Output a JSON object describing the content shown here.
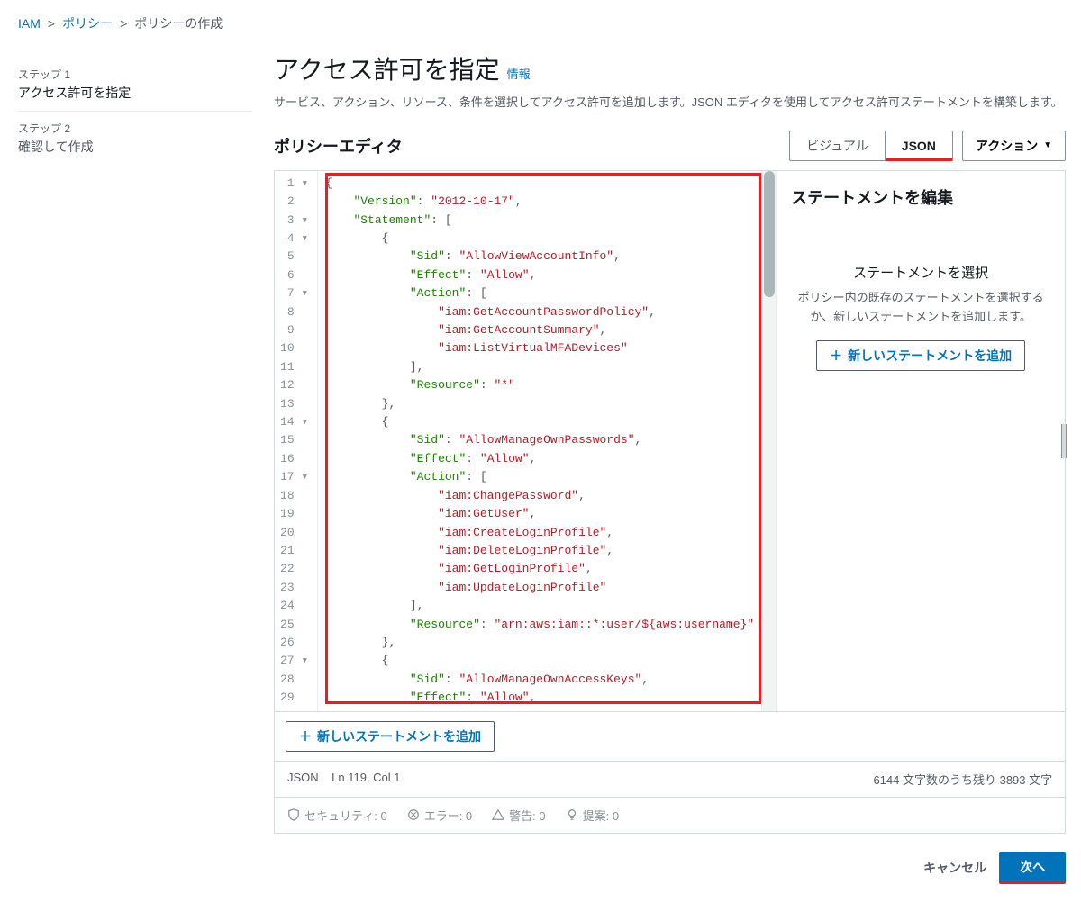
{
  "breadcrumb": {
    "iam": "IAM",
    "policy": "ポリシー",
    "create": "ポリシーの作成"
  },
  "steps": {
    "s1_label": "ステップ 1",
    "s1_title": "アクセス許可を指定",
    "s2_label": "ステップ 2",
    "s2_title": "確認して作成"
  },
  "page": {
    "title": "アクセス許可を指定",
    "info": "情報",
    "desc": "サービス、アクション、リソース、条件を選択してアクセス許可を追加します。JSON エディタを使用してアクセス許可ステートメントを構築します。"
  },
  "editor": {
    "title": "ポリシーエディタ",
    "visual": "ビジュアル",
    "json": "JSON",
    "actions": "アクション"
  },
  "statement_panel": {
    "title": "ステートメントを編集",
    "sel_title": "ステートメントを選択",
    "sel_desc": "ポリシー内の既存のステートメントを選択するか、新しいステートメントを追加します。",
    "add_btn": "新しいステートメントを追加"
  },
  "add_statement_btn2": "新しいステートメントを追加",
  "status": {
    "mode": "JSON",
    "cursor": "Ln 119, Col 1",
    "chars": "6144 文字数のうち残り 3893 文字"
  },
  "diagnostics": {
    "security": "セキュリティ: 0",
    "errors": "エラー: 0",
    "warnings": "警告: 0",
    "suggestions": "提案: 0"
  },
  "footer": {
    "cancel": "キャンセル",
    "next": "次へ"
  },
  "policy_json": {
    "Version": "2012-10-17",
    "Statement": [
      {
        "Sid": "AllowViewAccountInfo",
        "Effect": "Allow",
        "Action": [
          "iam:GetAccountPasswordPolicy",
          "iam:GetAccountSummary",
          "iam:ListVirtualMFADevices"
        ],
        "Resource": "*"
      },
      {
        "Sid": "AllowManageOwnPasswords",
        "Effect": "Allow",
        "Action": [
          "iam:ChangePassword",
          "iam:GetUser",
          "iam:CreateLoginProfile",
          "iam:DeleteLoginProfile",
          "iam:GetLoginProfile",
          "iam:UpdateLoginProfile"
        ],
        "Resource": "arn:aws:iam::*:user/${aws:username}"
      },
      {
        "Sid": "AllowManageOwnAccessKeys",
        "Effect": "Allow"
      }
    ]
  },
  "code_lines": [
    [
      [
        "p",
        "{"
      ]
    ],
    [
      [
        "p",
        "    "
      ],
      [
        "k",
        "\"Version\""
      ],
      [
        "p",
        ": "
      ],
      [
        "s",
        "\"2012-10-17\""
      ],
      [
        "p",
        ","
      ]
    ],
    [
      [
        "p",
        "    "
      ],
      [
        "k",
        "\"Statement\""
      ],
      [
        "p",
        ": ["
      ]
    ],
    [
      [
        "p",
        "        {"
      ]
    ],
    [
      [
        "p",
        "            "
      ],
      [
        "k",
        "\"Sid\""
      ],
      [
        "p",
        ": "
      ],
      [
        "s",
        "\"AllowViewAccountInfo\""
      ],
      [
        "p",
        ","
      ]
    ],
    [
      [
        "p",
        "            "
      ],
      [
        "k",
        "\"Effect\""
      ],
      [
        "p",
        ": "
      ],
      [
        "s",
        "\"Allow\""
      ],
      [
        "p",
        ","
      ]
    ],
    [
      [
        "p",
        "            "
      ],
      [
        "k",
        "\"Action\""
      ],
      [
        "p",
        ": ["
      ]
    ],
    [
      [
        "p",
        "                "
      ],
      [
        "s",
        "\"iam:GetAccountPasswordPolicy\""
      ],
      [
        "p",
        ","
      ]
    ],
    [
      [
        "p",
        "                "
      ],
      [
        "s",
        "\"iam:GetAccountSummary\""
      ],
      [
        "p",
        ","
      ]
    ],
    [
      [
        "p",
        "                "
      ],
      [
        "s",
        "\"iam:ListVirtualMFADevices\""
      ]
    ],
    [
      [
        "p",
        "            ],"
      ]
    ],
    [
      [
        "p",
        "            "
      ],
      [
        "k",
        "\"Resource\""
      ],
      [
        "p",
        ": "
      ],
      [
        "s",
        "\"*\""
      ]
    ],
    [
      [
        "p",
        "        },"
      ]
    ],
    [
      [
        "p",
        "        {"
      ]
    ],
    [
      [
        "p",
        "            "
      ],
      [
        "k",
        "\"Sid\""
      ],
      [
        "p",
        ": "
      ],
      [
        "s",
        "\"AllowManageOwnPasswords\""
      ],
      [
        "p",
        ","
      ]
    ],
    [
      [
        "p",
        "            "
      ],
      [
        "k",
        "\"Effect\""
      ],
      [
        "p",
        ": "
      ],
      [
        "s",
        "\"Allow\""
      ],
      [
        "p",
        ","
      ]
    ],
    [
      [
        "p",
        "            "
      ],
      [
        "k",
        "\"Action\""
      ],
      [
        "p",
        ": ["
      ]
    ],
    [
      [
        "p",
        "                "
      ],
      [
        "s",
        "\"iam:ChangePassword\""
      ],
      [
        "p",
        ","
      ]
    ],
    [
      [
        "p",
        "                "
      ],
      [
        "s",
        "\"iam:GetUser\""
      ],
      [
        "p",
        ","
      ]
    ],
    [
      [
        "p",
        "                "
      ],
      [
        "s",
        "\"iam:CreateLoginProfile\""
      ],
      [
        "p",
        ","
      ]
    ],
    [
      [
        "p",
        "                "
      ],
      [
        "s",
        "\"iam:DeleteLoginProfile\""
      ],
      [
        "p",
        ","
      ]
    ],
    [
      [
        "p",
        "                "
      ],
      [
        "s",
        "\"iam:GetLoginProfile\""
      ],
      [
        "p",
        ","
      ]
    ],
    [
      [
        "p",
        "                "
      ],
      [
        "s",
        "\"iam:UpdateLoginProfile\""
      ]
    ],
    [
      [
        "p",
        "            ],"
      ]
    ],
    [
      [
        "p",
        "            "
      ],
      [
        "k",
        "\"Resource\""
      ],
      [
        "p",
        ": "
      ],
      [
        "s",
        "\"arn:aws:iam::*:user/${aws:username}\""
      ]
    ],
    [
      [
        "p",
        "        },"
      ]
    ],
    [
      [
        "p",
        "        {"
      ]
    ],
    [
      [
        "p",
        "            "
      ],
      [
        "k",
        "\"Sid\""
      ],
      [
        "p",
        ": "
      ],
      [
        "s",
        "\"AllowManageOwnAccessKeys\""
      ],
      [
        "p",
        ","
      ]
    ],
    [
      [
        "p",
        "            "
      ],
      [
        "k",
        "\"Effect\""
      ],
      [
        "p",
        ": "
      ],
      [
        "s",
        "\"Allow\""
      ],
      [
        "p",
        ","
      ]
    ]
  ],
  "fold_lines": [
    1,
    3,
    4,
    7,
    14,
    17,
    27
  ]
}
